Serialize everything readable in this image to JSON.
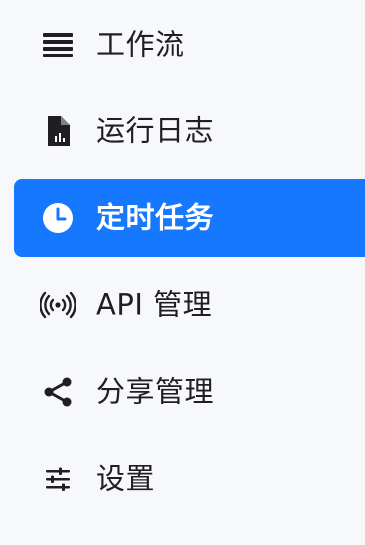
{
  "sidebar": {
    "items": [
      {
        "label": "工作流",
        "icon": "workflow-lines-icon",
        "active": false
      },
      {
        "label": "运行日志",
        "icon": "log-file-chart-icon",
        "active": false
      },
      {
        "label": "定时任务",
        "icon": "clock-icon",
        "active": true
      },
      {
        "label": "API 管理",
        "icon": "broadcast-signal-icon",
        "active": false
      },
      {
        "label": "分享管理",
        "icon": "share-icon",
        "active": false
      },
      {
        "label": "设置",
        "icon": "sliders-icon",
        "active": false
      }
    ]
  },
  "colors": {
    "background": "#f7f8fa",
    "active_background": "#1677ff",
    "active_text": "#ffffff",
    "text": "#1f1f23"
  }
}
